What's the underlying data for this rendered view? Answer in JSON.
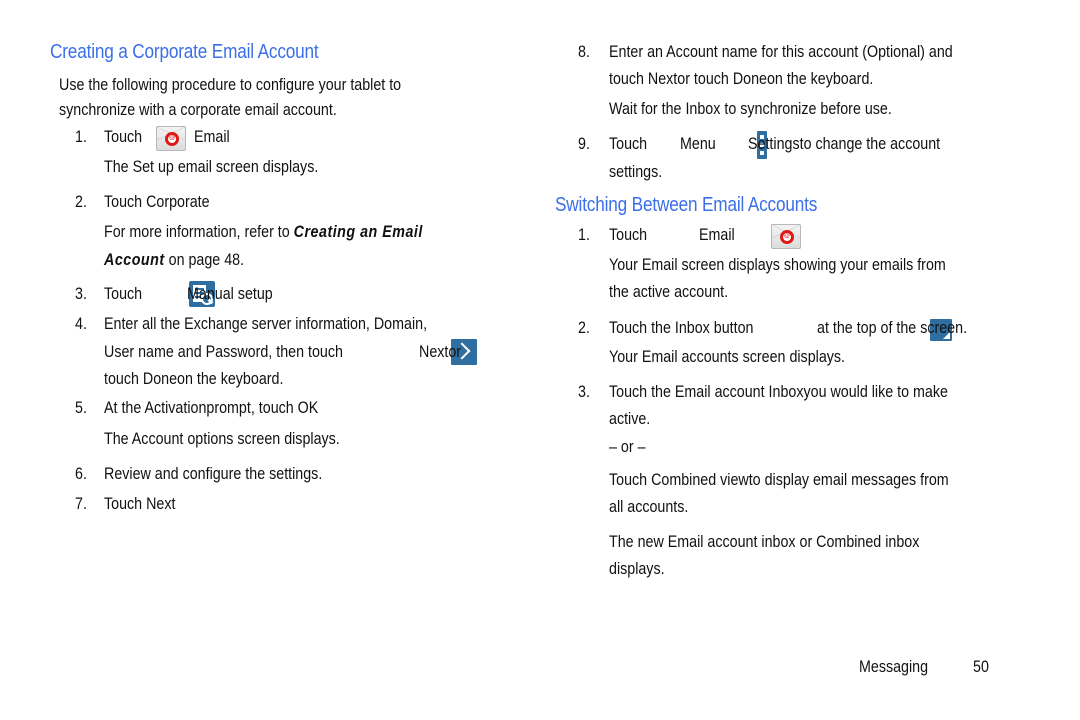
{
  "left": {
    "heading": "Creating a Corporate Email Account",
    "intro_line1": "Use the following procedure to configure your tablet to",
    "intro_line2": "synchronize with a corporate email account.",
    "steps": [
      {
        "num": "1.",
        "pre": "Touch",
        "icon": "email-icon",
        "post": "Email",
        "note": "The Set up email screen displays."
      },
      {
        "num": "2.",
        "text": "Touch Corporate",
        "note_pre": "For more information, refer to",
        "note_link": "Creating an Email",
        "note_link2": "Account",
        "note_post": "on page 48."
      },
      {
        "num": "3.",
        "pre": "Touch",
        "icon": "manual-setup-icon",
        "post": "Manual setup"
      },
      {
        "num": "4.",
        "line1": "Enter all the Exchange server information, Domain,",
        "line2_pre": "User name and Password, then touch",
        "icon": "next-arrow-icon",
        "line2_post": "Nextor",
        "line3": "touch Doneon the keyboard."
      },
      {
        "num": "5.",
        "text": "At the Activationprompt, touch OK",
        "note": "The Account options screen displays."
      },
      {
        "num": "6.",
        "text": "Review and configure the settings."
      },
      {
        "num": "7.",
        "text": "Touch Next"
      }
    ]
  },
  "right": {
    "steps_cont": [
      {
        "num": "8.",
        "line1": "Enter an Account name for this account (Optional) and",
        "line2": "touch Nextor touch Doneon the keyboard.",
        "note": "Wait for the Inbox to synchronize before use."
      },
      {
        "num": "9.",
        "pre": "Touch",
        "icon": "menu-icon",
        "mid": "Menu",
        "post": "Settingsto change the account",
        "line2": "settings."
      }
    ],
    "heading": "Switching Between Email Accounts",
    "steps": [
      {
        "num": "1.",
        "pre": "Touch",
        "icon": "email-icon",
        "post": "Email",
        "note1": "Your Email screen displays showing your emails from",
        "note2": "the active account."
      },
      {
        "num": "2.",
        "pre": "Touch the Inbox button",
        "icon": "inbox-icon",
        "post": "at the top of the screen.",
        "note": "Your Email accounts screen displays."
      },
      {
        "num": "3.",
        "line1": "Touch the Email account Inboxyou would like to make",
        "line2": "active.",
        "or": "– or –",
        "alt1": "Touch Combined viewto display email messages from",
        "alt2": "all accounts.",
        "result1": "The new Email account inbox or Combined inbox",
        "result2": "displays."
      }
    ]
  },
  "footer": {
    "section": "Messaging",
    "page": "50"
  },
  "colors": {
    "heading": "#3a6fe8",
    "icon_blue": "#2f6ea0",
    "email_red": "#e01818"
  }
}
